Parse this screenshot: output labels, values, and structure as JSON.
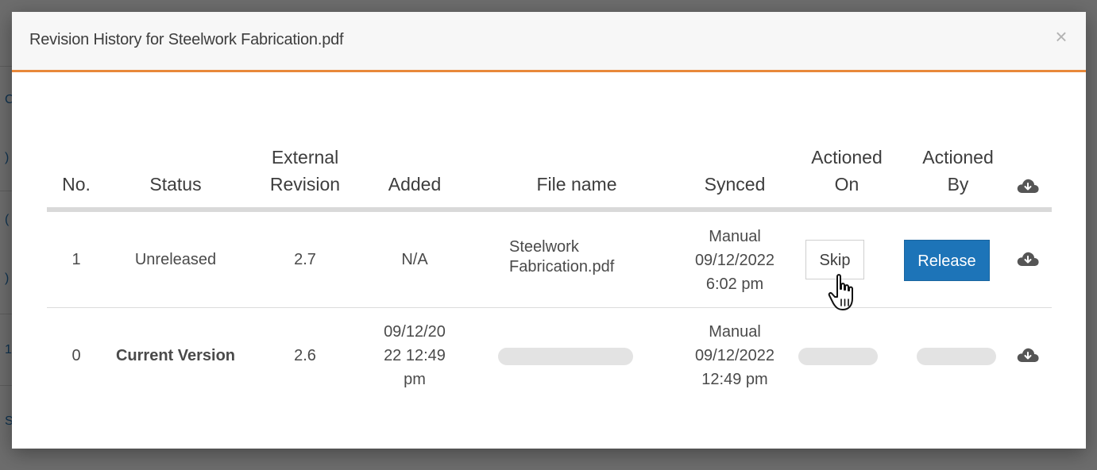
{
  "background": {
    "edge_chars": [
      "C",
      ")",
      "(",
      ")",
      "1",
      "S"
    ]
  },
  "modal": {
    "title": "Revision History for Steelwork Fabrication.pdf",
    "close_label": "×",
    "accent_color": "#e8883a"
  },
  "table": {
    "headers": {
      "no": "No.",
      "status": "Status",
      "external_revision_1": "External",
      "external_revision_2": "Revision",
      "added": "Added",
      "file_name": "File name",
      "synced": "Synced",
      "actioned_on_1": "Actioned",
      "actioned_on_2": "On",
      "actioned_by_1": "Actioned",
      "actioned_by_2": "By",
      "download_icon": "cloud-download-icon"
    },
    "rows": [
      {
        "no": "1",
        "status": "Unreleased",
        "external_revision": "2.7",
        "added": "N/A",
        "file_name_1": "Steelwork",
        "file_name_2": "Fabrication.pdf",
        "synced_1": "Manual",
        "synced_2": "09/12/2022",
        "synced_3": "6:02 pm",
        "skip_label": "Skip",
        "release_label": "Release",
        "download_icon": "cloud-download-icon"
      },
      {
        "no": "0",
        "status": "Current Version",
        "external_revision": "2.6",
        "added_1": "09/12/20",
        "added_2": "22 12:49",
        "added_3": "pm",
        "synced_1": "Manual",
        "synced_2": "09/12/2022",
        "synced_3": "12:49 pm",
        "download_icon": "cloud-download-icon"
      }
    ]
  },
  "colors": {
    "release_button": "#1d74b8",
    "icon": "#555555"
  }
}
